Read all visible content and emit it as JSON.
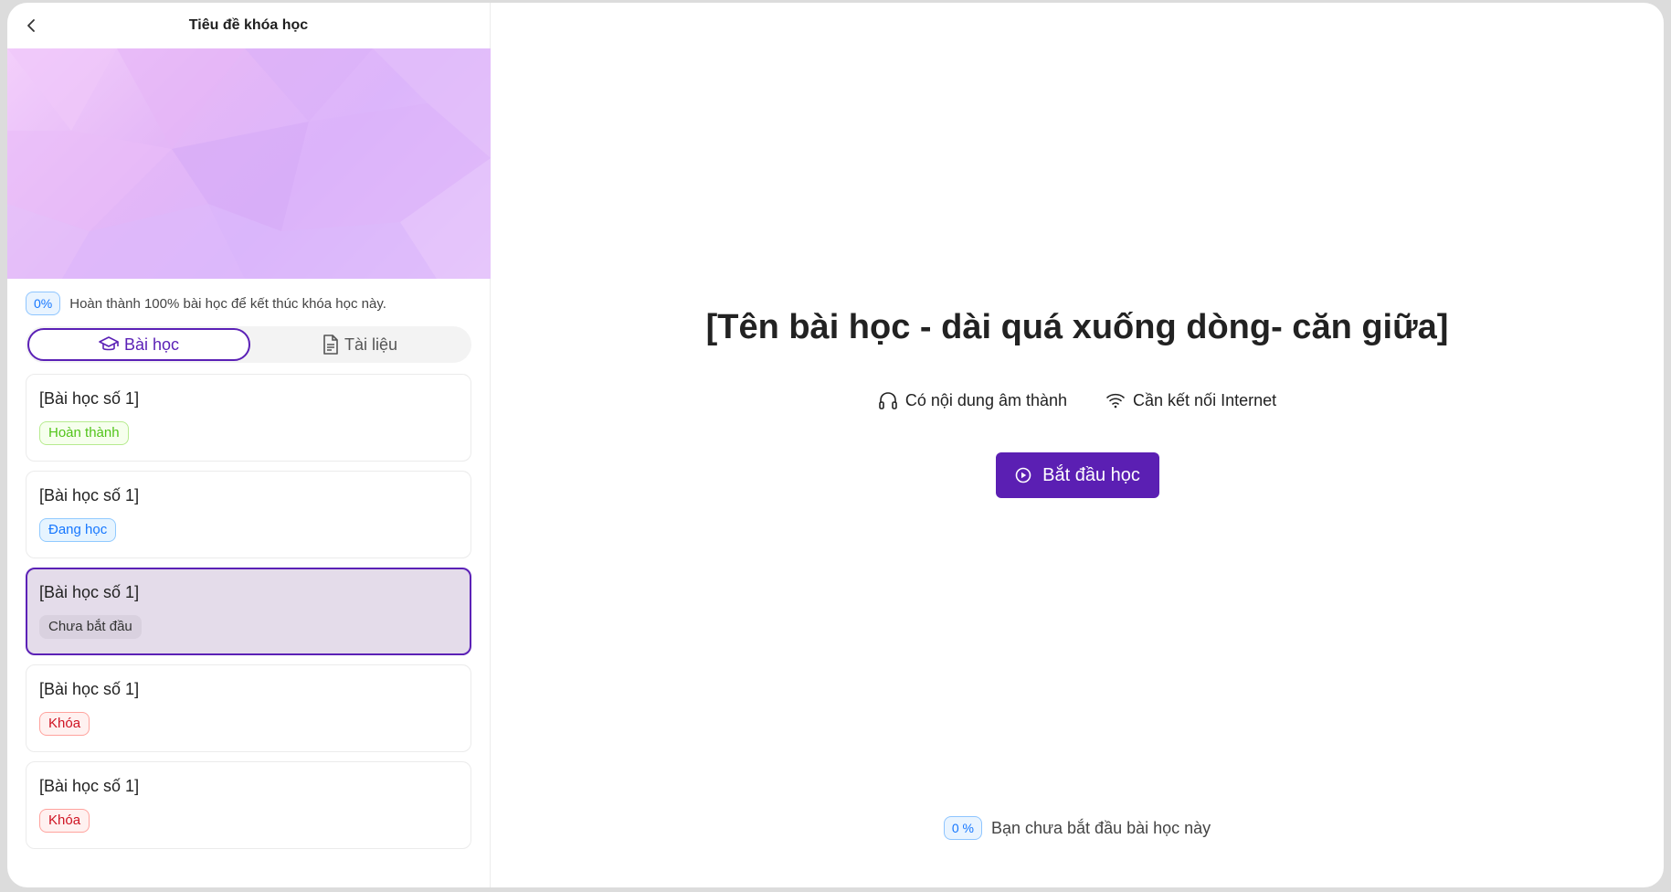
{
  "header": {
    "title": "Tiêu đề khóa học",
    "back_icon": "chevron-left-icon"
  },
  "progress": {
    "percent_label": "0%",
    "message": "Hoàn thành 100% bài học để kết thúc khóa học này."
  },
  "tabs": [
    {
      "label": "Bài học",
      "icon": "graduation-cap-icon",
      "active": true
    },
    {
      "label": "Tài liệu",
      "icon": "document-icon",
      "active": false
    }
  ],
  "lessons": [
    {
      "title": "[Bài học số 1]",
      "status": "Hoàn thành",
      "status_type": "done"
    },
    {
      "title": "[Bài học số 1]",
      "status": "Đang học",
      "status_type": "learning"
    },
    {
      "title": "[Bài học số 1]",
      "status": "Chưa bắt đầu",
      "status_type": "notstarted",
      "selected": true
    },
    {
      "title": "[Bài học số 1]",
      "status": "Khóa",
      "status_type": "locked"
    },
    {
      "title": "[Bài học số 1]",
      "status": "Khóa",
      "status_type": "locked"
    }
  ],
  "main": {
    "lesson_title": "[Tên bài học - dài quá xuống dòng- căn giữa]",
    "features": [
      {
        "icon": "headphones-icon",
        "label": "Có nội dung âm thành"
      },
      {
        "icon": "wifi-icon",
        "label": "Cần kết nối Internet"
      }
    ],
    "start_button": {
      "label": "Bắt đầu học",
      "icon": "play-circle-icon"
    },
    "bottom_status": {
      "percent_label": "0 %",
      "message": "Bạn chưa bắt đầu bài học này"
    }
  },
  "colors": {
    "primary": "#5b1fb3",
    "done": "#52c41a",
    "learning": "#1677ff",
    "locked": "#cf1322"
  }
}
